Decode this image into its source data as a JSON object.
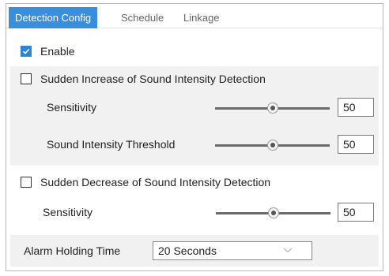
{
  "tabs": [
    {
      "label": "Detection Config",
      "active": true
    },
    {
      "label": "Schedule",
      "active": false
    },
    {
      "label": "Linkage",
      "active": false
    }
  ],
  "enable": {
    "label": "Enable",
    "checked": true
  },
  "increase": {
    "label": "Sudden Increase of Sound Intensity Detection",
    "checked": false,
    "sensitivity": {
      "label": "Sensitivity",
      "value": "50"
    },
    "threshold": {
      "label": "Sound Intensity Threshold",
      "value": "50"
    }
  },
  "decrease": {
    "label": "Sudden Decrease of Sound Intensity Detection",
    "checked": false,
    "sensitivity": {
      "label": "Sensitivity",
      "value": "50"
    }
  },
  "alarm_holding": {
    "label": "Alarm Holding Time",
    "value": "20 Seconds"
  },
  "colors": {
    "accent": "#3a8ede",
    "checkbox": "#2d84d6",
    "panel": "#f1f1f1"
  }
}
